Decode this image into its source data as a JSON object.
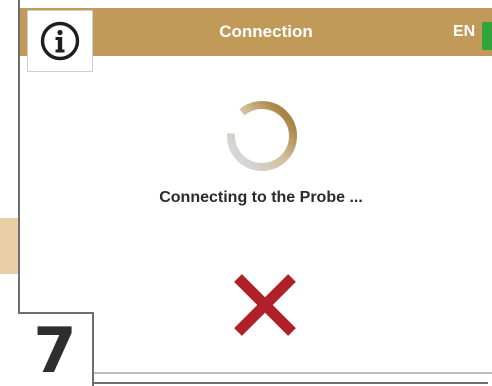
{
  "header": {
    "title": "Connection",
    "language": "EN",
    "info_icon": "info-circle-icon",
    "battery_icon": "battery-full-icon",
    "background_color": "#c19a5a",
    "battery_color": "#2ea63a"
  },
  "main": {
    "spinner_icon": "loading-spinner-icon",
    "status_text": "Connecting to the Probe ...",
    "cancel_icon": "close-x-icon",
    "cancel_color": "#b0202a"
  },
  "step": {
    "number": "7"
  }
}
